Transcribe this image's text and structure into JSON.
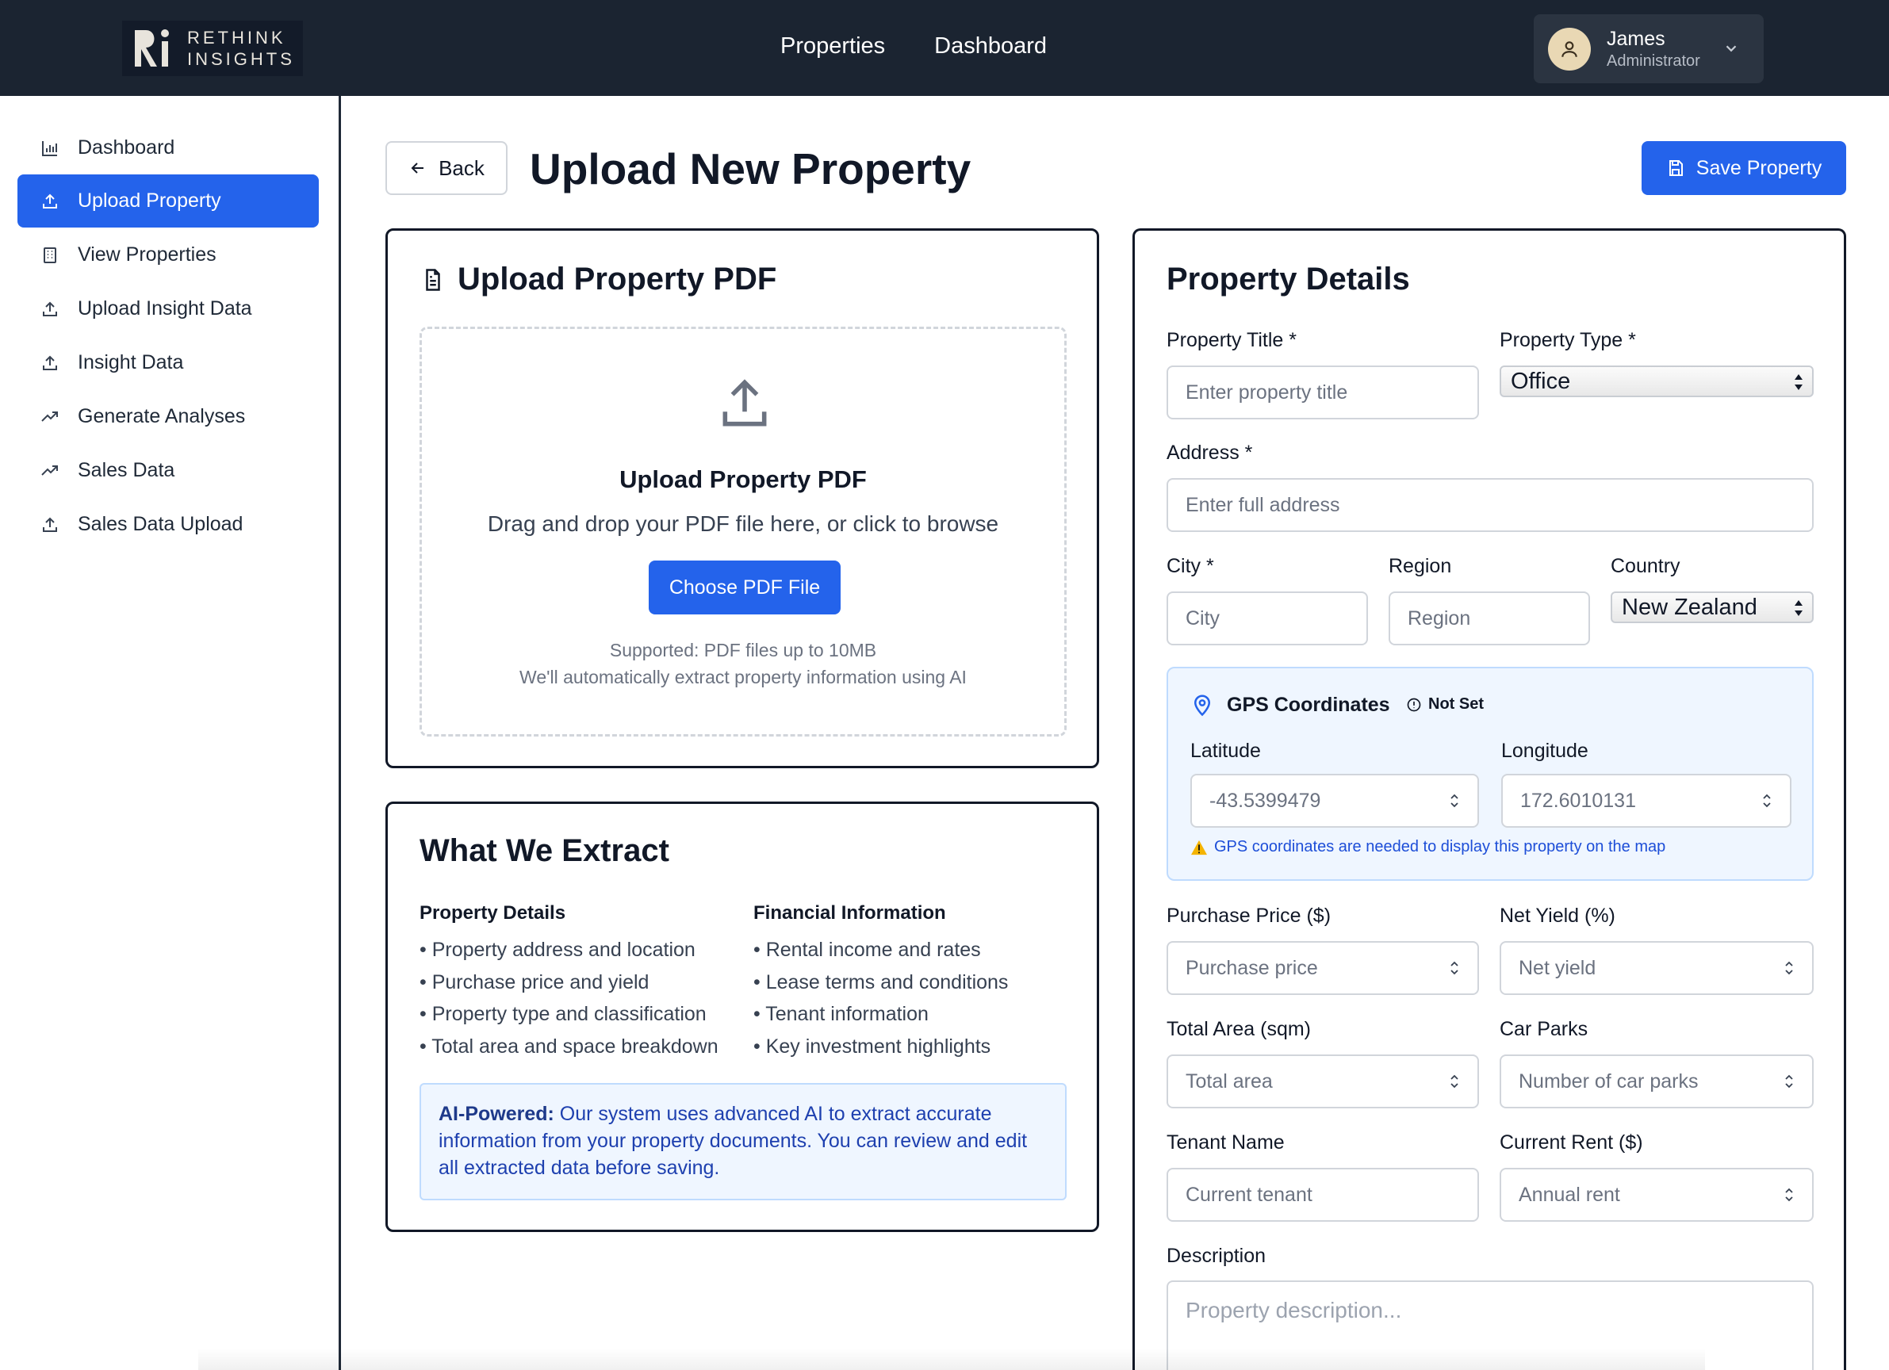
{
  "brand": {
    "line1": "RETHINK",
    "line2": "INSIGHTS"
  },
  "topnav": {
    "properties": "Properties",
    "dashboard": "Dashboard"
  },
  "user": {
    "name": "James",
    "role": "Administrator"
  },
  "sidebar": {
    "items": [
      {
        "label": "Dashboard",
        "icon": "bar-chart-icon"
      },
      {
        "label": "Upload Property",
        "icon": "upload-icon",
        "active": true
      },
      {
        "label": "View Properties",
        "icon": "building-icon"
      },
      {
        "label": "Upload Insight Data",
        "icon": "upload-icon"
      },
      {
        "label": "Insight Data",
        "icon": "upload-icon"
      },
      {
        "label": "Generate Analyses",
        "icon": "trending-up-icon"
      },
      {
        "label": "Sales Data",
        "icon": "trending-up-icon"
      },
      {
        "label": "Sales Data Upload",
        "icon": "upload-icon"
      }
    ]
  },
  "header": {
    "back_label": "Back",
    "title": "Upload New Property",
    "save_label": "Save Property"
  },
  "upload": {
    "title": "Upload Property PDF",
    "dz_title": "Upload Property PDF",
    "dz_sub": "Drag and drop your PDF file here, or click to browse",
    "button": "Choose PDF File",
    "note1": "Supported: PDF files up to 10MB",
    "note2": "We'll automatically extract property information using AI"
  },
  "extract": {
    "title": "What We Extract",
    "col1_head": "Property Details",
    "col1": [
      "• Property address and location",
      "• Purchase price and yield",
      "• Property type and classification",
      "• Total area and space breakdown"
    ],
    "col2_head": "Financial Information",
    "col2": [
      "• Rental income and rates",
      "• Lease terms and conditions",
      "• Tenant information",
      "• Key investment highlights"
    ],
    "ai_strong": "AI-Powered:",
    "ai_text": " Our system uses advanced AI to extract accurate information from your property documents. You can review and edit all extracted data before saving."
  },
  "details": {
    "title": "Property Details",
    "property_title_label": "Property Title *",
    "property_title_placeholder": "Enter property title",
    "property_type_label": "Property Type *",
    "property_type_value": "Office",
    "address_label": "Address *",
    "address_placeholder": "Enter full address",
    "city_label": "City *",
    "city_placeholder": "City",
    "region_label": "Region",
    "region_placeholder": "Region",
    "country_label": "Country",
    "country_value": "New Zealand",
    "gps_title": "GPS Coordinates",
    "gps_badge": "Not Set",
    "latitude_label": "Latitude",
    "latitude_value": "-43.5399479",
    "longitude_label": "Longitude",
    "longitude_value": "172.6010131",
    "gps_warning": "GPS coordinates are needed to display this property on the map",
    "purchase_label": "Purchase Price ($)",
    "purchase_placeholder": "Purchase price",
    "yield_label": "Net Yield (%)",
    "yield_placeholder": "Net yield",
    "area_label": "Total Area (sqm)",
    "area_placeholder": "Total area",
    "carparks_label": "Car Parks",
    "carparks_placeholder": "Number of car parks",
    "tenant_label": "Tenant Name",
    "tenant_placeholder": "Current tenant",
    "rent_label": "Current Rent ($)",
    "rent_placeholder": "Annual rent",
    "description_label": "Description",
    "description_placeholder": "Property description..."
  },
  "colors": {
    "accent": "#2463eb",
    "header_bg": "#1b2431",
    "info_bg": "#eff6ff"
  }
}
